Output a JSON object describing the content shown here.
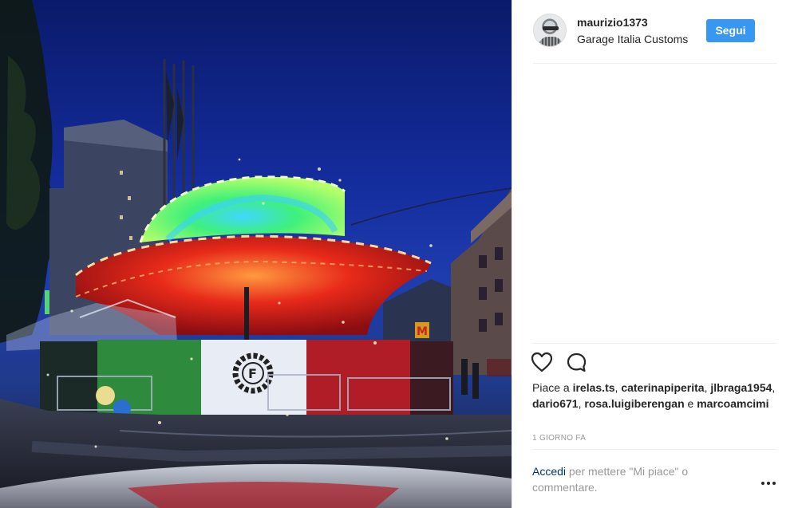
{
  "post": {
    "photo_alt": "",
    "user": {
      "username": "maurizio1373",
      "location": "Garage Italia Customs",
      "follow_label": "Segui"
    },
    "actions": {
      "like_icon": "heart-icon",
      "comment_icon": "comment-icon"
    },
    "likes": {
      "prefix": "Piace a",
      "names": [
        "irelas.ts",
        "caterinapiperita",
        "jlbraga1954",
        "dario671",
        "rosa.luigiberengan",
        "marcoamcimi"
      ],
      "sep1": ", ",
      "and_word": "e"
    },
    "time": "1 GIORNO FA",
    "login": {
      "link": "Accedi",
      "text": "per mettere \"Mi piace\" o commentare."
    },
    "more_icon": "more-options-icon",
    "colors": {
      "follow_button": "#3897f0",
      "link": "#003569",
      "muted": "#999999"
    }
  }
}
